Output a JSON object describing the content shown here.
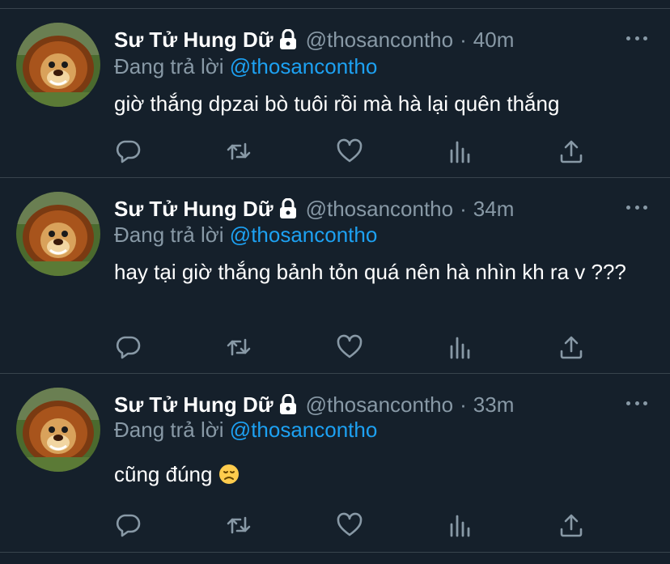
{
  "colors": {
    "background": "#15202b",
    "divider": "#38444d",
    "secondary_text": "#8899a6",
    "mention": "#1da1f2",
    "primary_text": "#ffffff"
  },
  "tweets": [
    {
      "name": "Sư Tử Hung Dữ",
      "handle": "@thosancontho",
      "separator": "·",
      "time": "40m",
      "reply_prefix": "Đang trả lời",
      "reply_to": "@thosancontho",
      "text": "giờ thắng dpzai bò tuôi rồi mà hà lại quên thắng",
      "emoji": null
    },
    {
      "name": "Sư Tử Hung Dữ",
      "handle": "@thosancontho",
      "separator": "·",
      "time": "34m",
      "reply_prefix": "Đang trả lời",
      "reply_to": "@thosancontho",
      "text": "hay tại giờ thắng bảnh tỏn quá nên hà nhìn kh ra v ???",
      "emoji": null
    },
    {
      "name": "Sư Tử Hung Dữ",
      "handle": "@thosancontho",
      "separator": "·",
      "time": "33m",
      "reply_prefix": "Đang trả lời",
      "reply_to": "@thosancontho",
      "text": "cũng đúng",
      "emoji": "disappointed-face"
    }
  ],
  "icons": {
    "protected": "lock-icon",
    "more": "more-icon",
    "reply": "reply-icon",
    "retweet": "retweet-icon",
    "like": "like-icon",
    "analytics": "analytics-icon",
    "share": "share-icon"
  }
}
